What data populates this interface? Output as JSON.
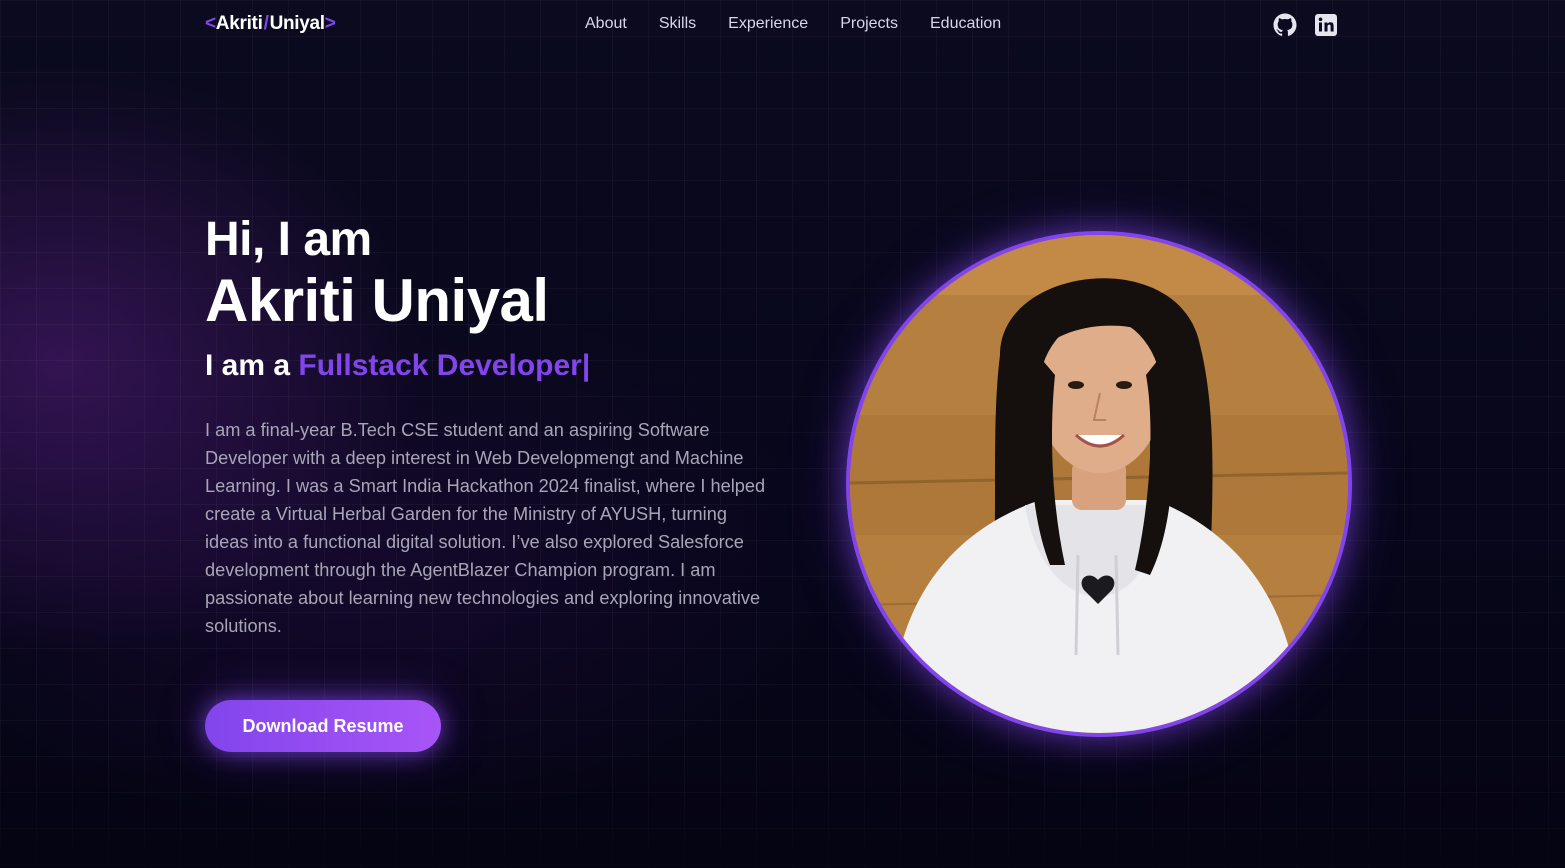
{
  "logo": {
    "open": "<",
    "first": "Akriti",
    "slash": "/",
    "last": "Uniyal",
    "close": ">"
  },
  "nav": {
    "links": [
      "About",
      "Skills",
      "Experience",
      "Projects",
      "Education"
    ],
    "icons": [
      "github-icon",
      "linkedin-icon"
    ]
  },
  "hero": {
    "greeting": "Hi, I am",
    "name": "Akriti Uniyal",
    "role_prefix": "I am a ",
    "role_typed": "Fullstack Developer|",
    "bio": "I am a final-year B.Tech CSE student and an aspiring Software Developer with a deep interest in Web Developmengt and Machine Learning. I was a Smart India Hackathon 2024 finalist, where I helped create a Virtual Herbal Garden for the Ministry of AYUSH, turning ideas into a functional digital solution. I’ve also explored Salesforce development through the AgentBlazer Champion program. I am passionate about learning new technologies and exploring innovative solutions.",
    "button": "Download Resume"
  },
  "colors": {
    "accent": "#8245ec",
    "background": "#050414",
    "text_muted": "#a8a5b8"
  }
}
